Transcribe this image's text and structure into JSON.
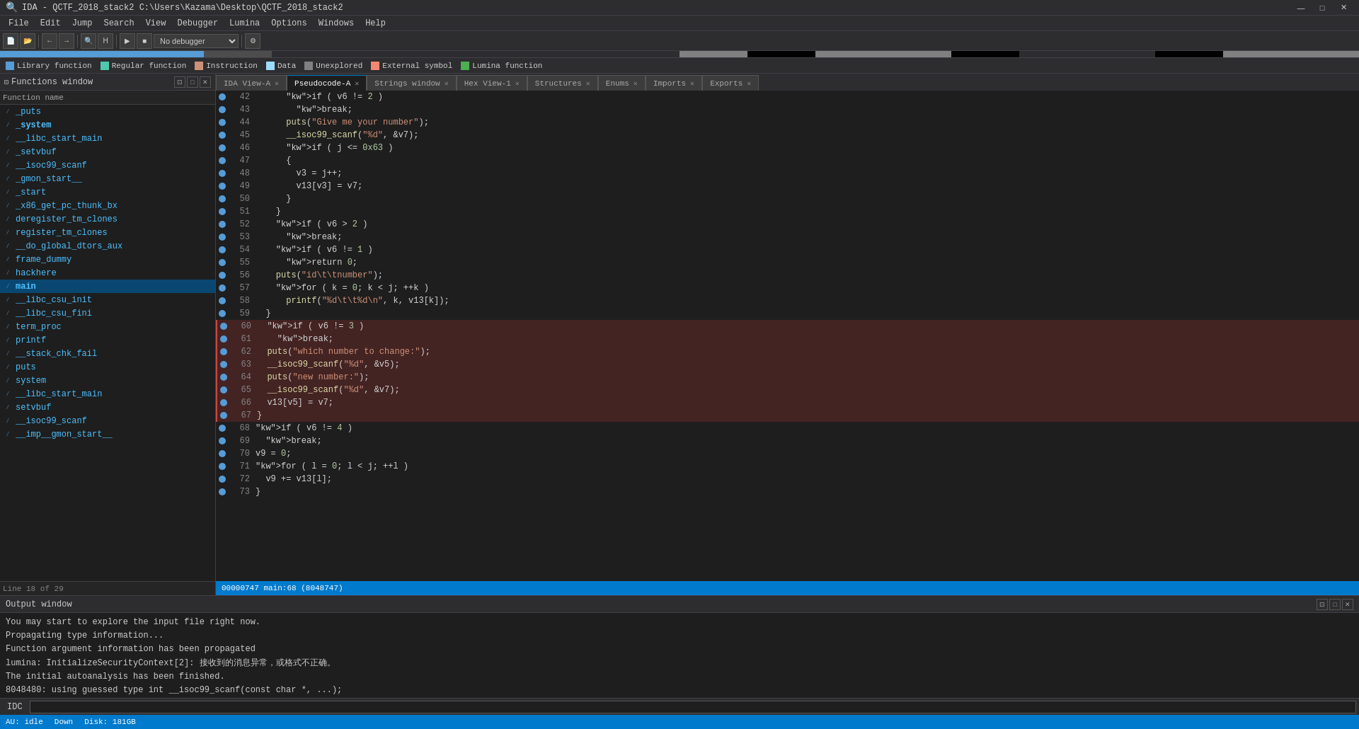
{
  "titlebar": {
    "title": "IDA - QCTF_2018_stack2 C:\\Users\\Kazama\\Desktop\\QCTF_2018_stack2",
    "icon": "🔍",
    "minimize": "—",
    "maximize": "□",
    "close": "✕"
  },
  "menubar": {
    "items": [
      "File",
      "Edit",
      "Jump",
      "Search",
      "View",
      "Debugger",
      "Lumina",
      "Options",
      "Windows",
      "Help"
    ]
  },
  "legend": {
    "items": [
      {
        "label": "Library function",
        "color": "#569cd6"
      },
      {
        "label": "Regular function",
        "color": "#4ec9b0"
      },
      {
        "label": "Instruction",
        "color": "#ce9178"
      },
      {
        "label": "Data",
        "color": "#9cdcfe"
      },
      {
        "label": "Unexplored",
        "color": "#808080"
      },
      {
        "label": "External symbol",
        "color": "#f48771"
      },
      {
        "label": "Lumina function",
        "color": "#4caf50"
      }
    ]
  },
  "functions_panel": {
    "title": "Functions window",
    "col_header": "Function name",
    "functions": [
      {
        "name": "_puts",
        "bold": false
      },
      {
        "name": "_system",
        "bold": true
      },
      {
        "name": "__libc_start_main",
        "bold": false
      },
      {
        "name": "_setvbuf",
        "bold": false
      },
      {
        "name": "__isoc99_scanf",
        "bold": false
      },
      {
        "name": "_gmon_start__",
        "bold": false
      },
      {
        "name": "_start",
        "bold": false
      },
      {
        "name": "_x86_get_pc_thunk_bx",
        "bold": false
      },
      {
        "name": "deregister_tm_clones",
        "bold": false
      },
      {
        "name": "register_tm_clones",
        "bold": false
      },
      {
        "name": "__do_global_dtors_aux",
        "bold": false
      },
      {
        "name": "frame_dummy",
        "bold": false
      },
      {
        "name": "hackhere",
        "bold": false
      },
      {
        "name": "main",
        "bold": true
      },
      {
        "name": "__libc_csu_init",
        "bold": false
      },
      {
        "name": "__libc_csu_fini",
        "bold": false
      },
      {
        "name": "term_proc",
        "bold": false
      },
      {
        "name": "printf",
        "bold": false
      },
      {
        "name": "__stack_chk_fail",
        "bold": false
      },
      {
        "name": "puts",
        "bold": false
      },
      {
        "name": "system",
        "bold": false
      },
      {
        "name": "__libc_start_main",
        "bold": false
      },
      {
        "name": "setvbuf",
        "bold": false
      },
      {
        "name": "__isoc99_scanf",
        "bold": false
      },
      {
        "name": "__imp__gmon_start__",
        "bold": false
      }
    ]
  },
  "tabs": [
    {
      "id": "ida-view",
      "label": "IDA View-A",
      "active": false,
      "closable": true
    },
    {
      "id": "pseudocode",
      "label": "Pseudocode-A",
      "active": true,
      "closable": true
    },
    {
      "id": "strings",
      "label": "Strings window",
      "active": false,
      "closable": true
    },
    {
      "id": "hex-view",
      "label": "Hex View-1",
      "active": false,
      "closable": true
    },
    {
      "id": "structures",
      "label": "Structures",
      "active": false,
      "closable": true
    },
    {
      "id": "enums",
      "label": "Enums",
      "active": false,
      "closable": true
    },
    {
      "id": "imports",
      "label": "Imports",
      "active": false,
      "closable": true
    },
    {
      "id": "exports",
      "label": "Exports",
      "active": false,
      "closable": true
    }
  ],
  "code_lines": [
    {
      "num": 42,
      "code": "      if ( v6 != 2 )",
      "highlighted": false
    },
    {
      "num": 43,
      "code": "        break;",
      "highlighted": false
    },
    {
      "num": 44,
      "code": "      puts(\"Give me your number\");",
      "highlighted": false
    },
    {
      "num": 45,
      "code": "      __isoc99_scanf(\"%d\", &v7);",
      "highlighted": false
    },
    {
      "num": 46,
      "code": "      if ( j <= 0x63 )",
      "highlighted": false
    },
    {
      "num": 47,
      "code": "      {",
      "highlighted": false
    },
    {
      "num": 48,
      "code": "        v3 = j++;",
      "highlighted": false
    },
    {
      "num": 49,
      "code": "        v13[v3] = v7;",
      "highlighted": false
    },
    {
      "num": 50,
      "code": "      }",
      "highlighted": false
    },
    {
      "num": 51,
      "code": "    }",
      "highlighted": false
    },
    {
      "num": 52,
      "code": "    if ( v6 > 2 )",
      "highlighted": false
    },
    {
      "num": 53,
      "code": "      break;",
      "highlighted": false
    },
    {
      "num": 54,
      "code": "    if ( v6 != 1 )",
      "highlighted": false
    },
    {
      "num": 55,
      "code": "      return 0;",
      "highlighted": false
    },
    {
      "num": 56,
      "code": "    puts(\"id\\t\\tnumber\");",
      "highlighted": false
    },
    {
      "num": 57,
      "code": "    for ( k = 0; k < j; ++k )",
      "highlighted": false
    },
    {
      "num": 58,
      "code": "      printf(\"%d\\t\\t%d\\n\", k, v13[k]);",
      "highlighted": false
    },
    {
      "num": 59,
      "code": "  }",
      "highlighted": false
    },
    {
      "num": 60,
      "code": "  if ( v6 != 3 )",
      "highlighted": true
    },
    {
      "num": 61,
      "code": "    break;",
      "highlighted": true
    },
    {
      "num": 62,
      "code": "  puts(\"which number to change:\");",
      "highlighted": true
    },
    {
      "num": 63,
      "code": "  __isoc99_scanf(\"%d\", &v5);",
      "highlighted": true
    },
    {
      "num": 64,
      "code": "  puts(\"new number:\");",
      "highlighted": true
    },
    {
      "num": 65,
      "code": "  __isoc99_scanf(\"%d\", &v7);",
      "highlighted": true
    },
    {
      "num": 66,
      "code": "  v13[v5] = v7;",
      "highlighted": true
    },
    {
      "num": 67,
      "code": "}",
      "highlighted": true
    },
    {
      "num": 68,
      "code": "if ( v6 != 4 )",
      "highlighted": false
    },
    {
      "num": 69,
      "code": "  break;",
      "highlighted": false
    },
    {
      "num": 70,
      "code": "v9 = 0;",
      "highlighted": false
    },
    {
      "num": 71,
      "code": "for ( l = 0; l < j; ++l )",
      "highlighted": false
    },
    {
      "num": 72,
      "code": "  v9 += v13[l];",
      "highlighted": false
    },
    {
      "num": 73,
      "code": "}",
      "highlighted": false
    }
  ],
  "status_line": "00000747 main:68 (8048747)",
  "output": {
    "title": "Output window",
    "lines": [
      "You may start to explore the input file right now.",
      "Propagating type information...",
      "Function argument information has been propagated",
      "lumina: InitializeSecurityContext[2]: 接收到的消息异常，或格式不正确。",
      "The initial autoanalysis has been finished.",
      "8048480: using guessed type int __isoc99_scanf(const char *, ...);"
    ]
  },
  "idc": {
    "label": "IDC",
    "placeholder": ""
  },
  "statusbar": {
    "state": "AU: idle",
    "scroll": "Down",
    "disk": "Disk: 181GB"
  },
  "line_info": "Line 18 of 29"
}
